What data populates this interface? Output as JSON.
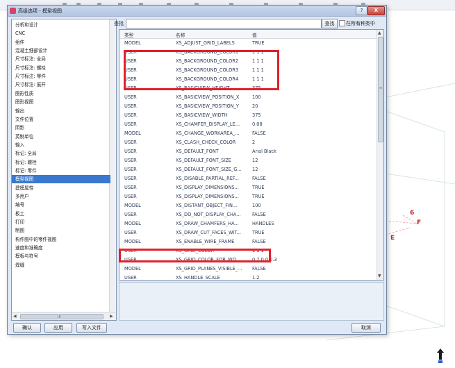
{
  "dialog": {
    "title": "高级选项 - 模型视图",
    "title_buttons": [
      "?",
      "X"
    ]
  },
  "categories": {
    "items": [
      "分析和设计",
      "CNC",
      "组件",
      "混凝土细部设计",
      "尺寸标注: 全局",
      "尺寸标注: 螺栓",
      "尺寸标注: 零件",
      "尺寸标注: 展开",
      "图形性质",
      "图形视图",
      "输出",
      "文件位置",
      "阴影",
      "英制单位",
      "输入",
      "标记: 全局",
      "标记: 螺栓",
      "标记: 零件",
      "模型视图",
      "建模属性",
      "多用户",
      "编号",
      "板工",
      "打印",
      "制图",
      "构件图中的零件视图",
      "速度和准确度",
      "模板与符号",
      "焊缝"
    ],
    "selected_index": 18,
    "hscroll_grip": "III"
  },
  "search": {
    "label": "查找",
    "value": "",
    "button_label": "查找",
    "checkbox_label": "在所有种类中",
    "checkbox_checked": false
  },
  "table": {
    "headers": [
      "类型",
      "名称",
      "值"
    ],
    "rows": [
      [
        "MODEL",
        "XS_ADJUST_GRID_LABELS",
        "TRUE"
      ],
      [
        "USER",
        "XS_BACKGROUND_COLOR1",
        "1 1 1"
      ],
      [
        "USER",
        "XS_BACKGROUND_COLOR2",
        "1 1 1"
      ],
      [
        "USER",
        "XS_BACKGROUND_COLOR3",
        "1 1 1"
      ],
      [
        "USER",
        "XS_BACKGROUND_COLOR4",
        "1 1 1"
      ],
      [
        "USER",
        "XS_BASICVIEW_HEIGHT",
        "375"
      ],
      [
        "USER",
        "XS_BASICVIEW_POSITION_X",
        "100"
      ],
      [
        "USER",
        "XS_BASICVIEW_POSITION_Y",
        "20"
      ],
      [
        "USER",
        "XS_BASICVIEW_WIDTH",
        "375"
      ],
      [
        "USER",
        "XS_CHAMFER_DISPLAY_LE...",
        "0.08"
      ],
      [
        "MODEL",
        "XS_CHANGE_WORKAREA_...",
        "FALSE"
      ],
      [
        "USER",
        "XS_CLASH_CHECK_COLOR",
        "2"
      ],
      [
        "USER",
        "XS_DEFAULT_FONT",
        "Arial Black"
      ],
      [
        "USER",
        "XS_DEFAULT_FONT_SIZE",
        "12"
      ],
      [
        "USER",
        "XS_DEFAULT_FONT_SIZE_G...",
        "12"
      ],
      [
        "USER",
        "XS_DISABLE_PARTIAL_REF...",
        "FALSE"
      ],
      [
        "USER",
        "XS_DISPLAY_DIMENSIONS...",
        "TRUE"
      ],
      [
        "USER",
        "XS_DISPLAY_DIMENSIONS...",
        "TRUE"
      ],
      [
        "MODEL",
        "XS_DISTANT_OBJECT_FIN...",
        "100"
      ],
      [
        "USER",
        "XS_DO_NOT_DISPLAY_CHA...",
        "FALSE"
      ],
      [
        "MODEL",
        "XS_DRAW_CHAMFERS_HA...",
        "HANDLES"
      ],
      [
        "USER",
        "XS_DRAW_CUT_FACES_WIT...",
        "TRUE"
      ],
      [
        "MODEL",
        "XS_ENABLE_WIRE_FRAME",
        "FALSE"
      ],
      [
        "USER",
        "XS_GRID_COLOR",
        "1 1 1"
      ],
      [
        "USER",
        "XS_GRID_COLOR_FOR_WO...",
        "0.7 0.0 0.3"
      ],
      [
        "MODEL",
        "XS_GRID_PLANES_VISIBLE_...",
        "FALSE"
      ],
      [
        "USER",
        "XS_HANDLE_SCALE",
        "1.2"
      ]
    ]
  },
  "buttons": {
    "ok": "确认",
    "apply": "应用",
    "write_file": "写入文件",
    "cancel": "取消"
  },
  "background": {
    "labels": [
      "6",
      "F",
      "E"
    ]
  },
  "colors": {
    "highlight": "#e0202a",
    "selection": "#3a78d0",
    "dialog_bg": "#dfe8f5"
  }
}
